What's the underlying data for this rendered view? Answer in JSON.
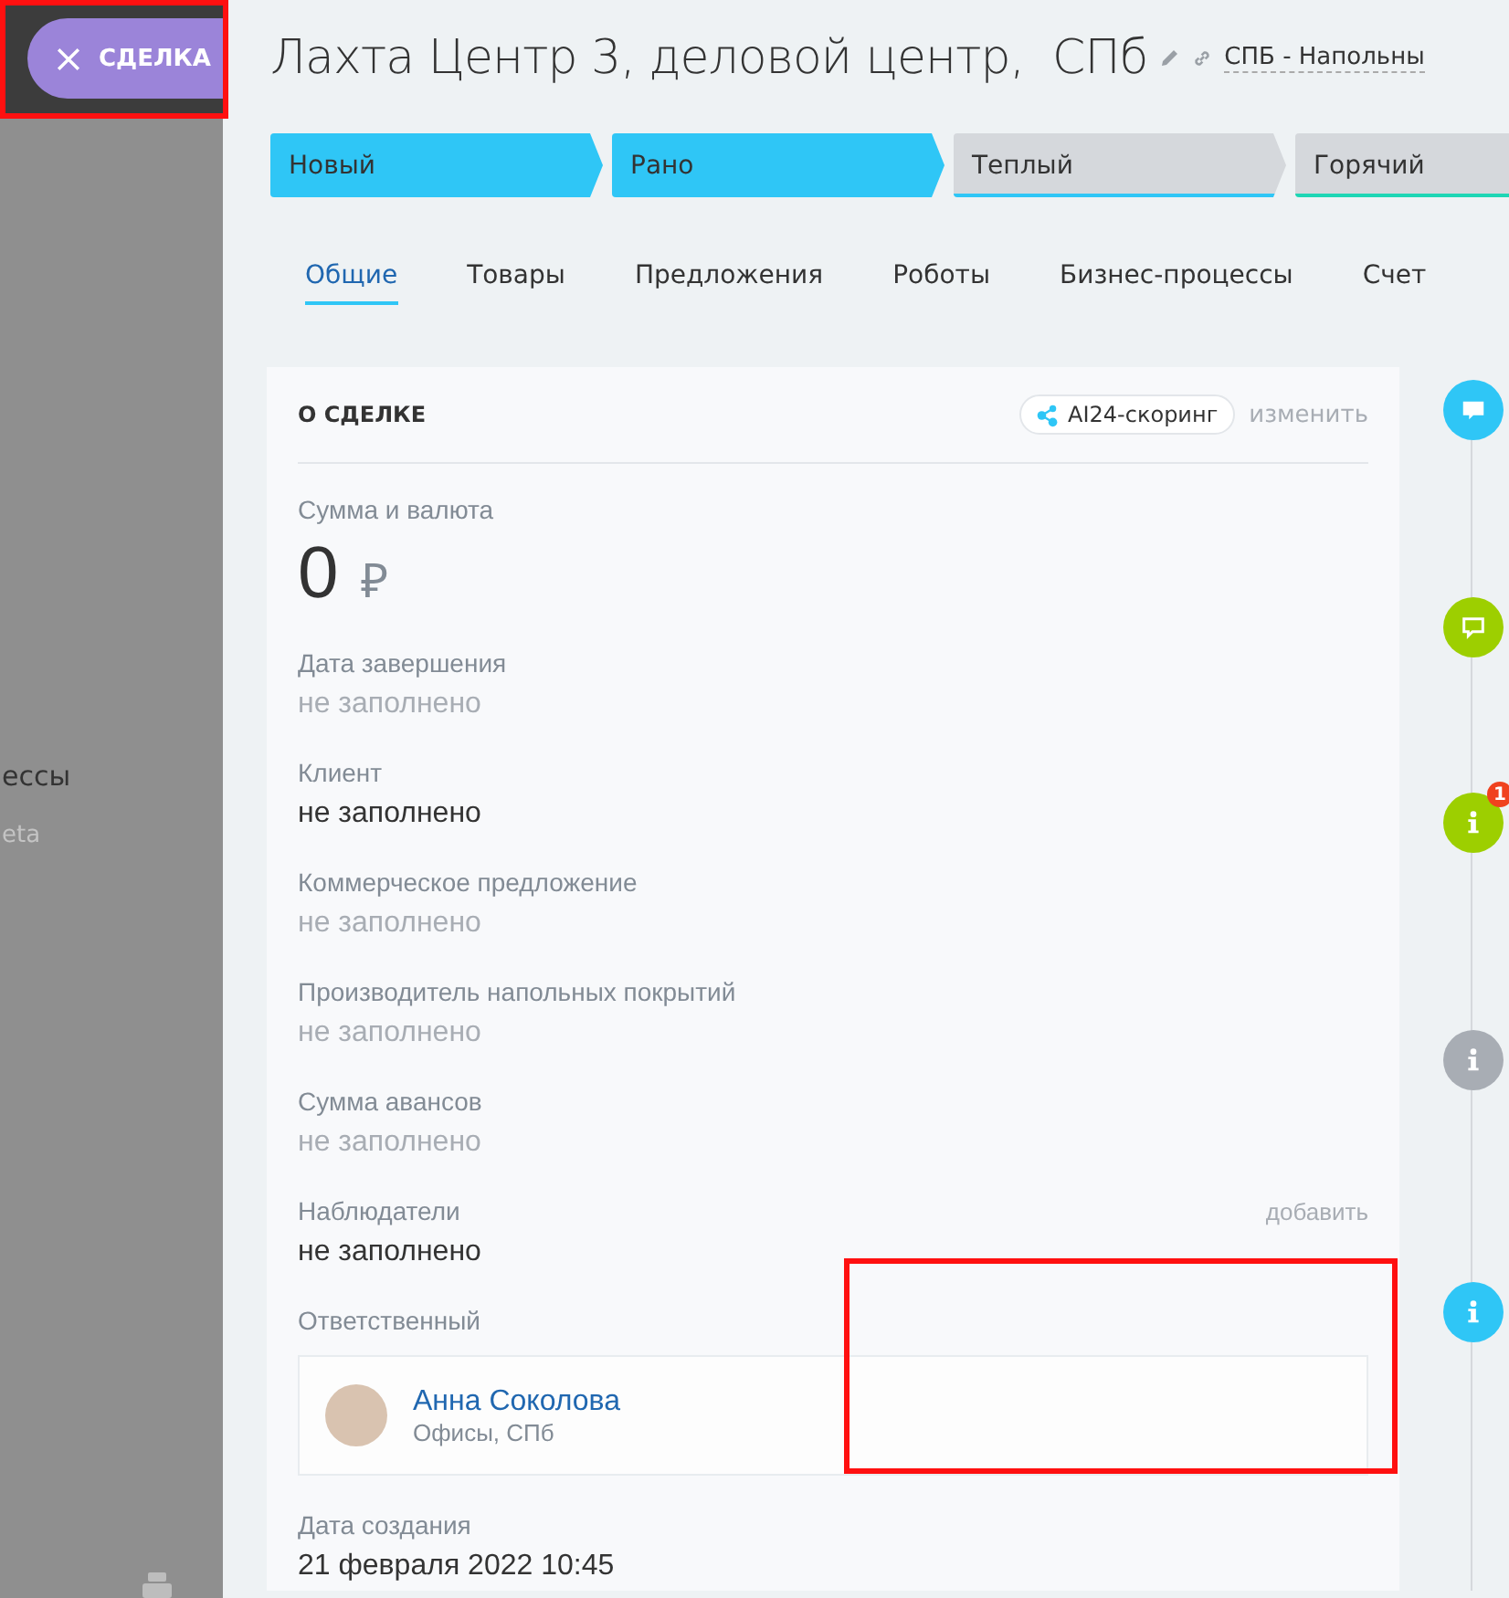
{
  "sidebar": {
    "close_button": {
      "label": "СДЕЛКА"
    },
    "items": [
      {
        "label": "ессы",
        "muted": false
      },
      {
        "label": "eta",
        "muted": true
      }
    ]
  },
  "title": "Лахта Центр 3, деловой центр,  СПб",
  "category": "СПБ - Напольны",
  "stages": [
    {
      "label": "Новый",
      "passed": true,
      "color": "#2fc6f6"
    },
    {
      "label": "Рано",
      "passed": true,
      "color": "#2fc6f6"
    },
    {
      "label": "Теплый",
      "passed": false,
      "color": "#2fc6f6"
    },
    {
      "label": "Горячий",
      "passed": false,
      "color": "#1ed6b5"
    }
  ],
  "tabs": [
    {
      "label": "Общие",
      "selected": true
    },
    {
      "label": "Товары",
      "selected": false
    },
    {
      "label": "Предложения",
      "selected": false
    },
    {
      "label": "Роботы",
      "selected": false
    },
    {
      "label": "Бизнес-процессы",
      "selected": false
    },
    {
      "label": "Счет",
      "selected": false
    }
  ],
  "card": {
    "title": "О СДЕЛКЕ",
    "scoring": "AI24-скоринг",
    "edit": "изменить",
    "fields": [
      {
        "kind": "amount",
        "label": "Сумма и валюта",
        "value": "0",
        "currency": "₽"
      },
      {
        "kind": "text",
        "label": "Дата завершения",
        "value": "не заполнено",
        "muted": true
      },
      {
        "kind": "text",
        "label": "Клиент",
        "value": "не заполнено",
        "muted": false
      },
      {
        "kind": "text",
        "label": "Коммерческое предложение",
        "value": "не заполнено",
        "muted": true
      },
      {
        "kind": "text",
        "label": "Производитель напольных покрытий",
        "value": "не заполнено",
        "muted": true
      },
      {
        "kind": "text",
        "label": "Сумма авансов",
        "value": "не заполнено",
        "muted": true
      },
      {
        "kind": "text",
        "label": "Наблюдатели",
        "value": "не заполнено",
        "muted": false,
        "action": "добавить"
      },
      {
        "kind": "person",
        "label": "Ответственный",
        "name": "Анна Соколова",
        "position": "Офисы, СПб"
      },
      {
        "kind": "text",
        "label": "Дата создания",
        "value": "21 февраля 2022 10:45",
        "muted": false
      }
    ]
  },
  "timeline": [
    {
      "kind": "comment",
      "color": "#2fc6f6"
    },
    {
      "kind": "message",
      "color": "#9dcf00"
    },
    {
      "kind": "info",
      "color": "#9dcf00",
      "badge": "1"
    },
    {
      "kind": "info",
      "color": "#a8adb4"
    },
    {
      "kind": "info",
      "color": "#2fc6f6"
    }
  ],
  "annotation_frames": [
    {
      "kind": "rectangle"
    },
    {
      "kind": "rectangle"
    }
  ]
}
